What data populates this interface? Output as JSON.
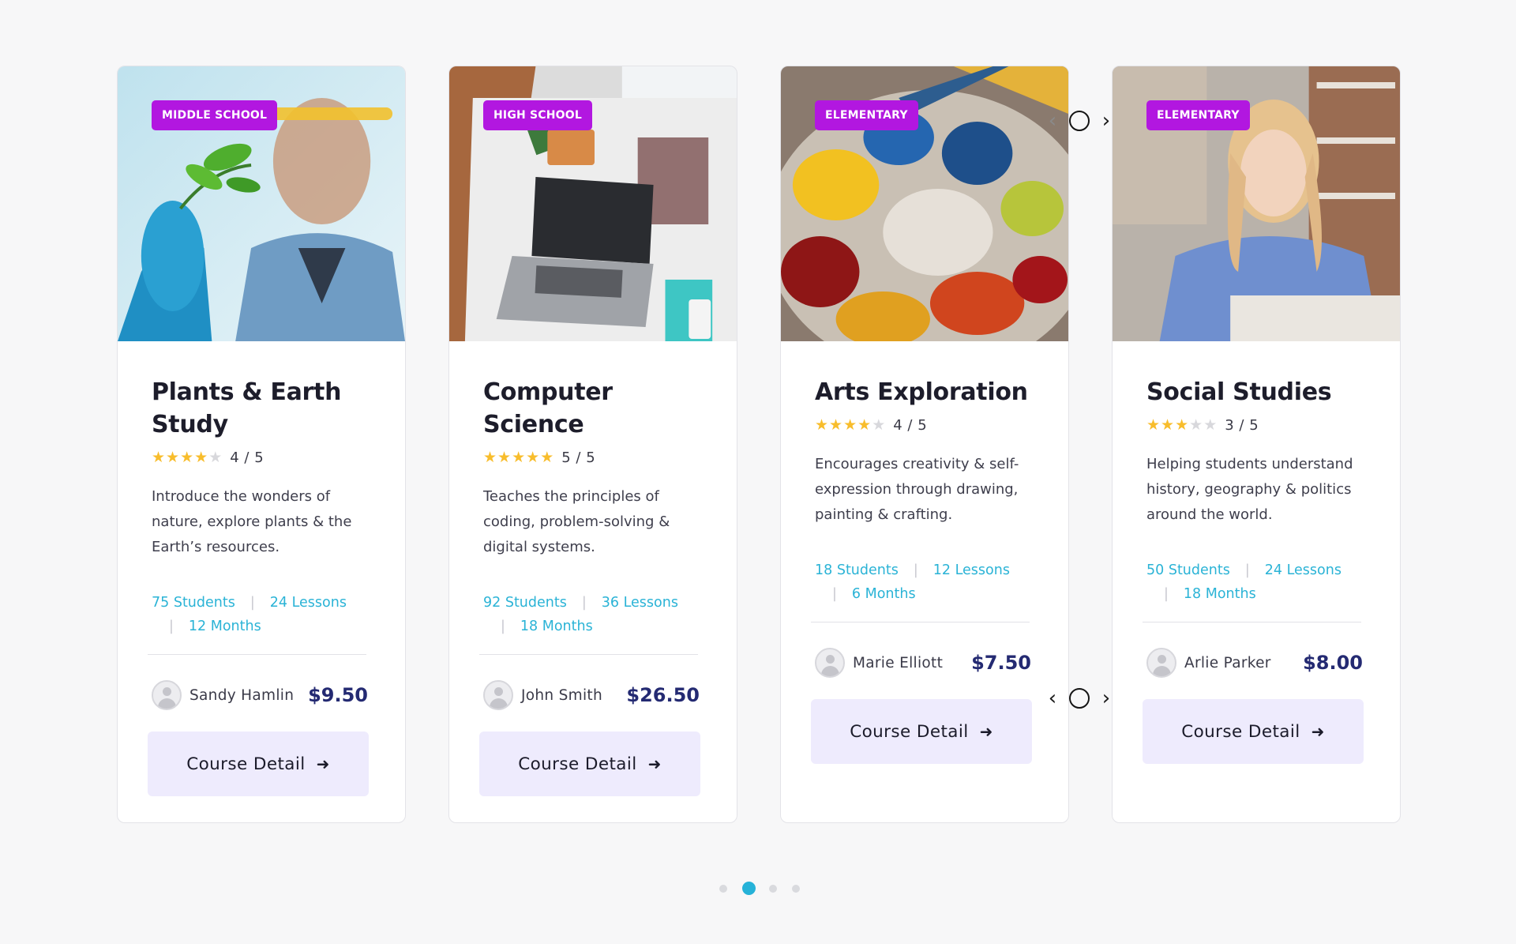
{
  "cards": [
    {
      "badge": "MIDDLE SCHOOL",
      "title": "Plants & Earth Study",
      "rating": 4,
      "rating_text": "4 / 5",
      "description": "Introduce the wonders of nature, explore plants & the Earth’s resources.",
      "students": "75 Students",
      "lessons": "24 Lessons",
      "duration": "12 Months",
      "author": "Sandy Hamlin",
      "price": "$9.50",
      "button": "Course Detail"
    },
    {
      "badge": "HIGH SCHOOL",
      "title": "Computer Science",
      "rating": 5,
      "rating_text": "5 / 5",
      "description": "Teaches the principles of coding, problem-solving & digital systems.",
      "students": "92 Students",
      "lessons": "36 Lessons",
      "duration": "18 Months",
      "author": "John Smith",
      "price": "$26.50",
      "button": "Course Detail"
    },
    {
      "badge": "ELEMENTARY",
      "title": "Arts Exploration",
      "rating": 4,
      "rating_text": "4 / 5",
      "description": "Encourages creativity & self-expression through drawing, painting & crafting.",
      "students": "18 Students",
      "lessons": "12 Lessons",
      "duration": "6 Months",
      "author": "Marie Elliott",
      "price": "$7.50",
      "button": "Course Detail"
    },
    {
      "badge": "ELEMENTARY",
      "title": "Social Studies",
      "rating": 3,
      "rating_text": "3 / 5",
      "description": "Helping students understand history, geography & politics around the world.",
      "students": "50 Students",
      "lessons": "24 Lessons",
      "duration": "18 Months",
      "author": "Arlie Parker",
      "price": "$8.00",
      "button": "Course Detail"
    }
  ],
  "icons": {
    "star": "star-icon",
    "arrow": "arrow-right-icon",
    "avatar": "user-avatar-icon",
    "prev": "chevron-left-icon",
    "next": "chevron-right-icon"
  },
  "glyphs": {
    "star": "★",
    "arrow": "➜",
    "prev": "‹",
    "next": "›"
  },
  "colors": {
    "badge": "#b217e0",
    "accent": "#2ab3d6",
    "price": "#242a72",
    "star_on": "#f8bd2c",
    "star_off": "#d8d8dc",
    "button_bg": "#eeebfd"
  },
  "pagination": {
    "total": 4,
    "active_index": 1
  }
}
